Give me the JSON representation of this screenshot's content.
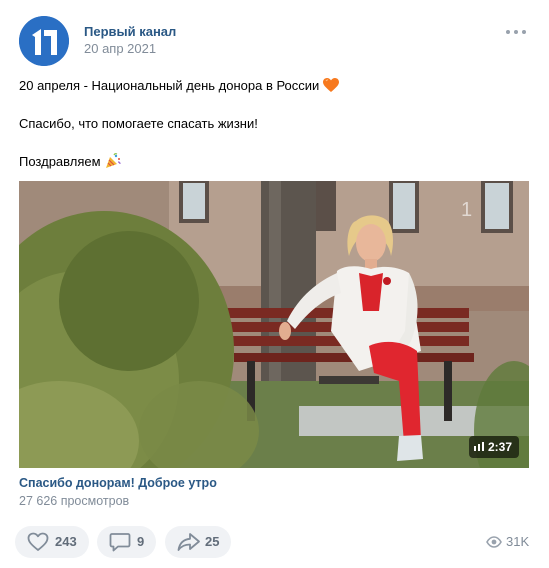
{
  "post": {
    "author": "Первый канал",
    "date": "20 апр 2021",
    "text_lines": [
      "20 апреля - Национальный день донора в России",
      "Спасибо, что помогаете спасать жизни!",
      "Поздравляем"
    ],
    "video": {
      "duration": "2:37",
      "title": "Спасибо донорам! Доброе утро",
      "views": "27 626 просмотров"
    },
    "actions": {
      "likes": "243",
      "comments": "9",
      "shares": "25",
      "views": "31K"
    },
    "icons": {
      "avatar": "channel-one-logo-icon",
      "more": "more-horizontal-icon",
      "heart_emoji": "orange-heart-emoji-icon",
      "party_emoji": "party-popper-emoji-icon",
      "like": "heart-outline-icon",
      "comment": "comment-icon",
      "share": "share-arrow-icon",
      "views": "eye-icon",
      "duration": "signal-bars-icon"
    },
    "colors": {
      "link": "#2a5885",
      "secondary": "#818c99",
      "action_bg": "#f0f2f5",
      "action_text": "#626d7a",
      "avatar_bg": "#2a6fc4"
    }
  }
}
